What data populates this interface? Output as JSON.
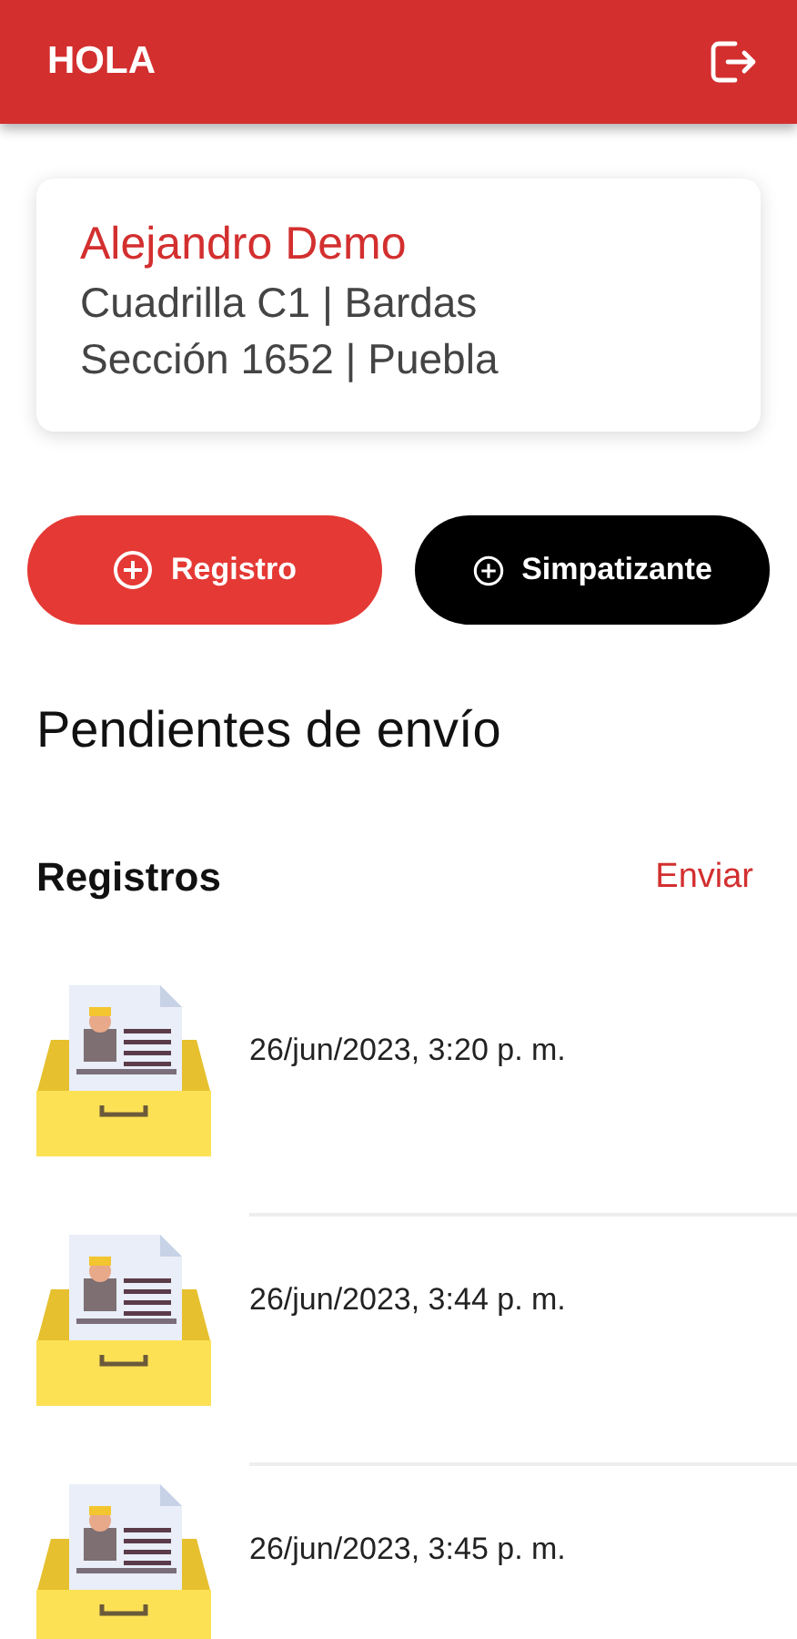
{
  "header": {
    "title": "HOLA"
  },
  "profile": {
    "name": "Alejandro Demo",
    "lines": [
      "Cuadrilla C1 | Bardas",
      "Sección 1652 | Puebla"
    ]
  },
  "actions": [
    {
      "label": "Registro",
      "kind": "primary"
    },
    {
      "label": "Simpatizante",
      "kind": "dark"
    }
  ],
  "section_title": "Pendientes de envío",
  "list": {
    "title": "Registros",
    "action": "Enviar",
    "items": [
      {
        "date": "26/jun/2023, 3:20 p. m."
      },
      {
        "date": "26/jun/2023, 3:44 p. m."
      },
      {
        "date": "26/jun/2023, 3:45 p. m."
      }
    ]
  }
}
